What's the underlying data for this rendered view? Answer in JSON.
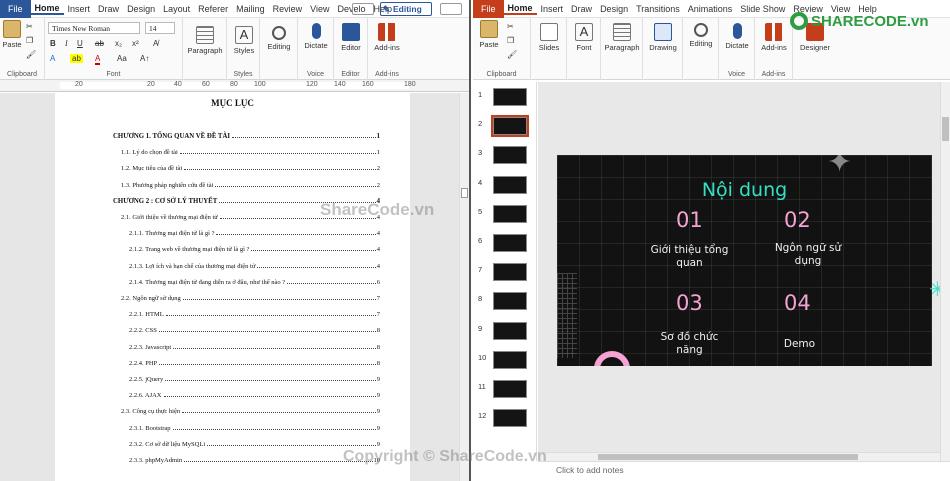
{
  "word": {
    "tabs": [
      "File",
      "Home",
      "Insert",
      "Draw",
      "Design",
      "Layout",
      "Referer",
      "Mailing",
      "Review",
      "View",
      "Develo",
      "Help"
    ],
    "mode": "Editing",
    "ribbon": {
      "paste": "Paste",
      "font_name": "Times New Roman",
      "font_size": "14",
      "paragraph": "Paragraph",
      "styles": "Styles",
      "editing": "Editing",
      "dictate": "Dictate",
      "editor": "Editor",
      "addins": "Add-ins",
      "groups": [
        "Clipboard",
        "Font",
        "Styles",
        "Voice",
        "Editor",
        "Add-ins"
      ]
    },
    "ruler": [
      "20",
      "20",
      "40",
      "60",
      "80",
      "100",
      "120",
      "140",
      "160",
      "180"
    ],
    "toc_title": "MỤC LỤC",
    "toc": [
      {
        "t": "CHƯƠNG 1. TỔNG QUAN VỀ ĐỀ TÀI",
        "p": "1",
        "lvl": 1
      },
      {
        "t": "1.1. Lý do chọn đề tài",
        "p": "1",
        "lvl": 2
      },
      {
        "t": "1.2. Mục tiêu của đề tài",
        "p": "2",
        "lvl": 2
      },
      {
        "t": "1.3. Phương pháp nghiên cứu đề tài",
        "p": "2",
        "lvl": 2
      },
      {
        "t": "CHƯƠNG 2 : CƠ SỞ LÝ THUYẾT",
        "p": "4",
        "lvl": 1
      },
      {
        "t": "2.1. Giới thiệu về thương mại điện tử",
        "p": "4",
        "lvl": 2
      },
      {
        "t": "2.1.1. Thương mại điện tử là gì ?",
        "p": "4",
        "lvl": 3
      },
      {
        "t": "2.1.2. Trang web về thương mại điện tử là gì ?",
        "p": "4",
        "lvl": 3
      },
      {
        "t": "2.1.3. Lợi ích và hạn chế của thương mại điện tử",
        "p": "4",
        "lvl": 3
      },
      {
        "t": "2.1.4. Thương mại điện tử đang diễn ra ở đâu, như thế nào ?",
        "p": "6",
        "lvl": 3
      },
      {
        "t": "2.2. Ngôn ngữ sử dụng",
        "p": "7",
        "lvl": 2
      },
      {
        "t": "2.2.1. HTML",
        "p": "7",
        "lvl": 3
      },
      {
        "t": "2.2.2. CSS",
        "p": "8",
        "lvl": 3
      },
      {
        "t": "2.2.3. Javascript",
        "p": "8",
        "lvl": 3
      },
      {
        "t": "2.2.4. PHP",
        "p": "8",
        "lvl": 3
      },
      {
        "t": "2.2.5. jQuery",
        "p": "9",
        "lvl": 3
      },
      {
        "t": "2.2.6. AJAX",
        "p": "9",
        "lvl": 3
      },
      {
        "t": "2.3. Công cụ thực hiện",
        "p": "9",
        "lvl": 2
      },
      {
        "t": "2.3.1. Bootstrap",
        "p": "9",
        "lvl": 3
      },
      {
        "t": "2.3.2. Cơ sở dữ liệu MySQLi",
        "p": "9",
        "lvl": 3
      },
      {
        "t": "2.3.3. phpMyAdmin",
        "p": "10",
        "lvl": 3
      }
    ]
  },
  "ppt": {
    "tabs": [
      "File",
      "Home",
      "Insert",
      "Draw",
      "Design",
      "Transitions",
      "Animations",
      "Slide Show",
      "Review",
      "View",
      "Help"
    ],
    "ribbon": {
      "paste": "Paste",
      "slides": "Slides",
      "font": "Font",
      "paragraph": "Paragraph",
      "drawing": "Drawing",
      "editing": "Editing",
      "dictate": "Dictate",
      "addins": "Add-ins",
      "designer": "Designer",
      "groups": [
        "Clipboard",
        "Voice",
        "Add-ins"
      ]
    },
    "thumbs": [
      "1",
      "2",
      "3",
      "4",
      "5",
      "6",
      "7",
      "8",
      "9",
      "10",
      "11",
      "12"
    ],
    "selected_slide": "2",
    "slide": {
      "title": "Nội dung",
      "items": [
        {
          "n": "01",
          "l": "Giới thiệu tổng quan"
        },
        {
          "n": "02",
          "l": "Ngôn ngữ sử dụng"
        },
        {
          "n": "03",
          "l": "Sơ đồ chức năng"
        },
        {
          "n": "04",
          "l": "Demo"
        }
      ]
    },
    "notes": "Click to add notes"
  },
  "watermarks": {
    "center": "ShareCode.vn",
    "bottom": "Copyright © ShareCode.vn",
    "logo": "SHARECODE.vn"
  }
}
